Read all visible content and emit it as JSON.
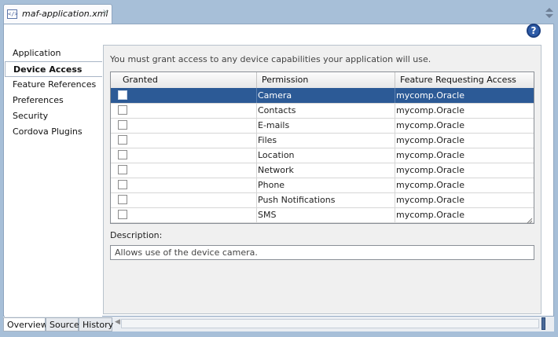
{
  "tab": {
    "title": "maf-application.xml",
    "close": "×",
    "icon": "xml-file-icon"
  },
  "help": {
    "label": "?"
  },
  "nav": {
    "items": [
      {
        "label": "Application",
        "selected": false
      },
      {
        "label": "Device Access",
        "selected": true
      },
      {
        "label": "Feature References",
        "selected": false
      },
      {
        "label": "Preferences",
        "selected": false
      },
      {
        "label": "Security",
        "selected": false
      },
      {
        "label": "Cordova Plugins",
        "selected": false
      }
    ]
  },
  "main": {
    "intro": "You must grant access to any device capabilities your application will use.",
    "table": {
      "columns": [
        "Granted",
        "Permission",
        "Feature Requesting Access"
      ],
      "rows": [
        {
          "granted": false,
          "permission": "Camera",
          "feature": "mycomp.Oracle",
          "selected": true
        },
        {
          "granted": false,
          "permission": "Contacts",
          "feature": "mycomp.Oracle"
        },
        {
          "granted": false,
          "permission": "E-mails",
          "feature": "mycomp.Oracle"
        },
        {
          "granted": false,
          "permission": "Files",
          "feature": "mycomp.Oracle"
        },
        {
          "granted": false,
          "permission": "Location",
          "feature": "mycomp.Oracle"
        },
        {
          "granted": false,
          "permission": "Network",
          "feature": "mycomp.Oracle"
        },
        {
          "granted": false,
          "permission": "Phone",
          "feature": "mycomp.Oracle"
        },
        {
          "granted": false,
          "permission": "Push Notifications",
          "feature": "mycomp.Oracle"
        },
        {
          "granted": false,
          "permission": "SMS",
          "feature": "mycomp.Oracle"
        }
      ]
    },
    "description_label": "Description:",
    "description": "Allows use of the device camera."
  },
  "bottom_tabs": [
    {
      "label": "Overview",
      "selected": true
    },
    {
      "label": "Source",
      "selected": false
    },
    {
      "label": "History",
      "selected": false
    }
  ],
  "colors": {
    "selection": "#2c5a96",
    "frame": "#a7bfd8"
  }
}
